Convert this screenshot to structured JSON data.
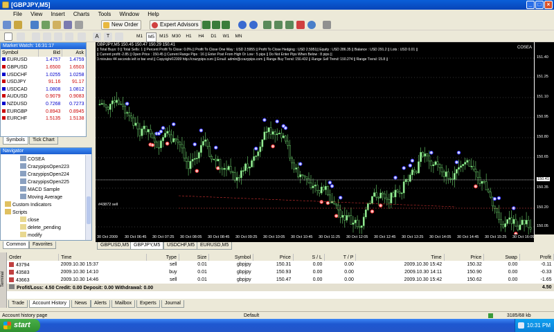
{
  "window": {
    "title": "[GBPJPY,M5]"
  },
  "menu": [
    "File",
    "View",
    "Insert",
    "Charts",
    "Tools",
    "Window",
    "Help"
  ],
  "toolbar": {
    "new_order": "New Order",
    "expert_advisors": "Expert Advisors",
    "timeframes": [
      "M1",
      "M5",
      "M15",
      "M30",
      "H1",
      "H4",
      "D1",
      "W1",
      "MN"
    ]
  },
  "market_watch": {
    "title": "Market Watch: 16:31:17",
    "headers": [
      "Symbol",
      "Bid",
      "Ask"
    ],
    "rows": [
      {
        "symbol": "EURUSD",
        "bid": "1.4757",
        "ask": "1.4759",
        "color": "#0000cc"
      },
      {
        "symbol": "GBPUSD",
        "bid": "1.6500",
        "ask": "1.6503",
        "color": "#cc0000"
      },
      {
        "symbol": "USDCHF",
        "bid": "1.0255",
        "ask": "1.0258",
        "color": "#0000cc"
      },
      {
        "symbol": "USDJPY",
        "bid": "91.16",
        "ask": "91.17",
        "color": "#cc0000"
      },
      {
        "symbol": "USDCAD",
        "bid": "1.0808",
        "ask": "1.0812",
        "color": "#0000cc"
      },
      {
        "symbol": "AUDUSD",
        "bid": "0.9079",
        "ask": "0.9083",
        "color": "#cc0000"
      },
      {
        "symbol": "NZDUSD",
        "bid": "0.7268",
        "ask": "0.7273",
        "color": "#0000cc"
      },
      {
        "symbol": "EURGBP",
        "bid": "0.8943",
        "ask": "0.8945",
        "color": "#cc0000"
      },
      {
        "symbol": "EURCHF",
        "bid": "1.5135",
        "ask": "1.5138",
        "color": "#cc0000"
      }
    ],
    "tabs": [
      "Symbols",
      "Tick Chart"
    ]
  },
  "navigator": {
    "title": "Navigator",
    "items": [
      "COSEA",
      "CrazypipsOpen223",
      "CrazypipsOpen224",
      "CrazypipsOpen225",
      "MACD Sample",
      "Moving Average"
    ],
    "custom_indicators": "Custom Indicators",
    "scripts": "Scripts",
    "script_items": [
      "close",
      "delete_pending",
      "modify"
    ],
    "tabs": [
      "Common",
      "Favorites"
    ]
  },
  "chart": {
    "header": "GBPJPY,M5  150.45 150.47 150.29 150.41",
    "ea_name": "COSEA",
    "info_line1": "|| Total Buys: 0 || Total Sells: 1 || Percent Profit To Close: 0.0% || Profit To Close One Way : USD 2.5955 || Profit To Close Hedging : USD 2.5951|| Equity : USD 286.35 || Balance : USD 291.2 || Lots : USD 0.01 ||",
    "info_line2": "|| Current profit:-2.85 || Open Price : 150.45 || Current Range Pips : 16 || Enter Post From High Or Low : 5 pips || Do Not Enter Pips When Below : 8 pips ||",
    "info_line3": "3 minutes 44 seconds left to bar end || Copyright©2009 http://crazypips.com || Email: admin@crazypips.com || Range Buy Trend: 150.432 || Range Sell Trend: 150.274 || Range Trend: 15.8 ||",
    "order_label": "#43872 sell",
    "price_ticks": [
      "151.40",
      "151.25",
      "151.10",
      "150.95",
      "150.80",
      "150.65",
      "150.41",
      "150.35",
      "150.20",
      "150.05"
    ],
    "price_tag": "150.41",
    "time_ticks": [
      "30 Oct 2009",
      "30 Oct 06:45",
      "30 Oct 07:25",
      "30 Oct 08:05",
      "30 Oct 08:45",
      "30 Oct 09:25",
      "30 Oct 10:05",
      "30 Oct 10:45",
      "30 Oct 11:25",
      "30 Oct 12:05",
      "30 Oct 12:45",
      "30 Oct 13:25",
      "30 Oct 14:05",
      "30 Oct 14:45",
      "30 Oct 15:25",
      "30 Oct 16:05"
    ],
    "tabs": [
      "GBPUSD,M5",
      "GBPJPY,M5",
      "USDCHF,M5",
      "EURUSD,M5"
    ]
  },
  "terminal": {
    "label": "Terminal",
    "headers": [
      "Order",
      "Time",
      "Type",
      "Size",
      "Symbol",
      "Price",
      "S / L",
      "T / P",
      "Time",
      "Price",
      "Swap",
      "Profit"
    ],
    "rows": [
      [
        "43794",
        "2009.10.30 15:37",
        "sell",
        "0.01",
        "gbpjpy",
        "150.31",
        "0.00",
        "0.00",
        "2009.10.30 15:42",
        "150.32",
        "0.00",
        "-0.11"
      ],
      [
        "43583",
        "2009.10.30 14:10",
        "buy",
        "0.01",
        "gbpjpy",
        "150.93",
        "0.00",
        "0.00",
        "2009.10.30 14:11",
        "150.90",
        "0.00",
        "-0.33"
      ],
      [
        "43663",
        "2009.10.30 14:46",
        "sell",
        "0.01",
        "gbpjpy",
        "150.47",
        "0.00",
        "0.00",
        "2009.10.30 15:42",
        "150.62",
        "0.00",
        "-1.65"
      ]
    ],
    "summary": "Profit/Loss: 4.50  Credit: 0.00  Deposit: 0.00  Withdrawal: 0.00",
    "summary_value": "4.50",
    "tabs": [
      "Trade",
      "Account History",
      "News",
      "Alerts",
      "Mailbox",
      "Experts",
      "Journal"
    ]
  },
  "status": {
    "left": "Account history page",
    "profile": "Default",
    "traffic": "3185/68 kb"
  },
  "taskbar": {
    "start": "start",
    "clock": "10:31 PM"
  }
}
